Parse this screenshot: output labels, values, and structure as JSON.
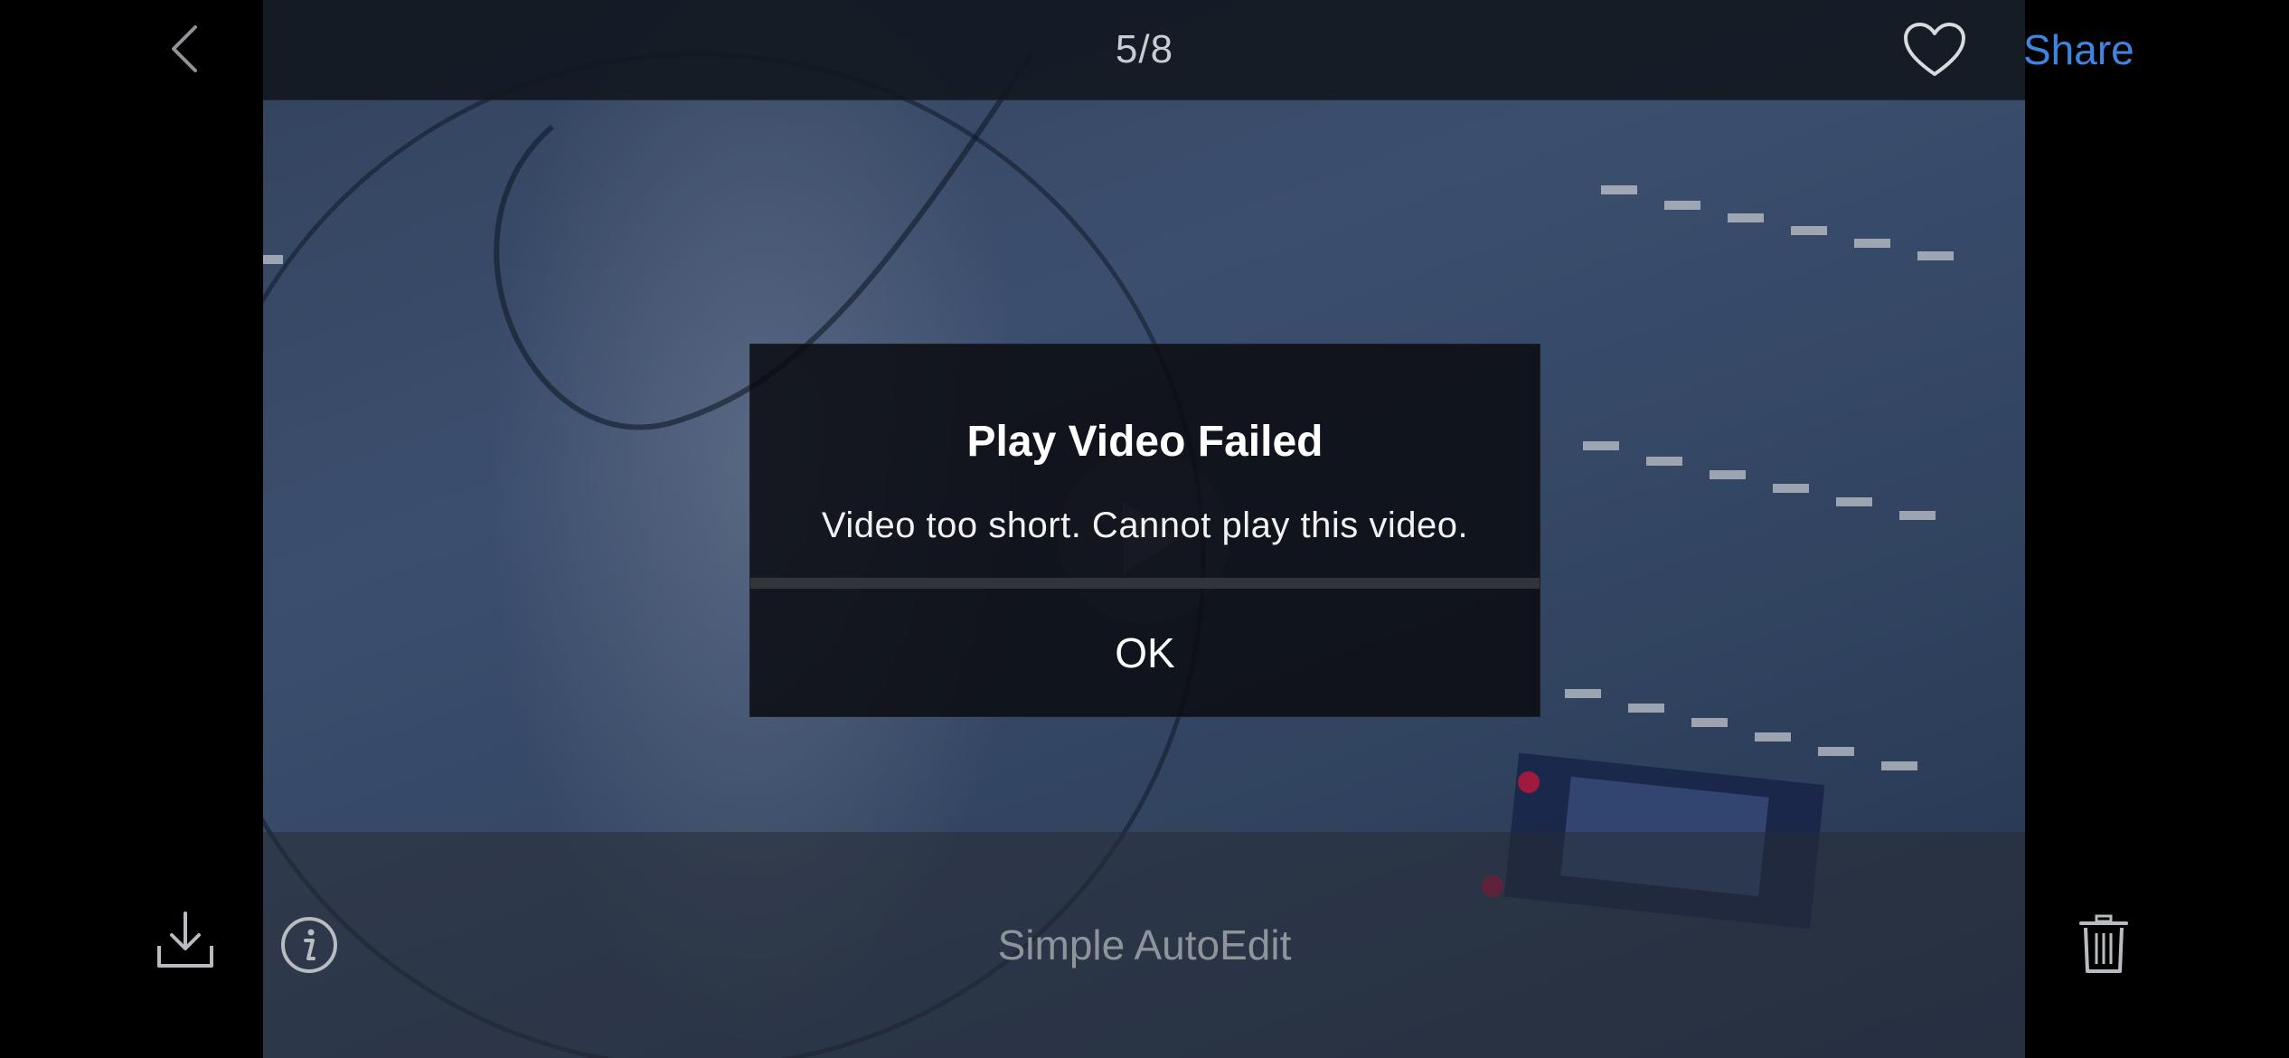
{
  "header": {
    "counter": "5/8",
    "share_label": "Share",
    "icons": {
      "back": "chevron-left-icon",
      "favorite": "heart-icon"
    }
  },
  "footer": {
    "title": "Simple AutoEdit",
    "icons": {
      "download": "download-icon",
      "info": "info-icon",
      "delete": "trash-icon"
    }
  },
  "dialog": {
    "title": "Play Video Failed",
    "message": "Video too short. Cannot play this video.",
    "ok_label": "OK"
  },
  "colors": {
    "accent": "#3d85e0",
    "dialog_background": "#0a0c10",
    "bar_background": "#121821"
  }
}
